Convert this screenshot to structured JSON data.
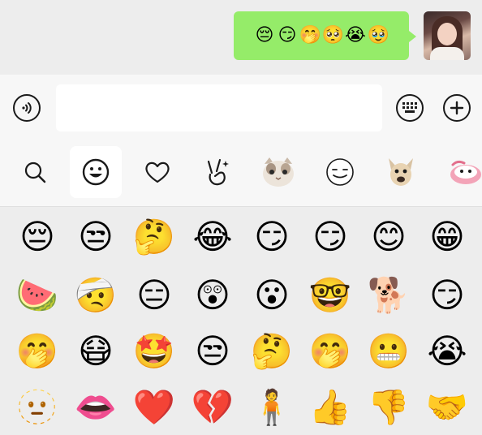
{
  "chat": {
    "sent_message_emojis": [
      "😔",
      "😏",
      "🤭",
      "🥺",
      "😭",
      "🥹"
    ]
  },
  "input": {
    "value": "",
    "placeholder": ""
  },
  "icons": {
    "voice": "voice-icon",
    "keyboard": "keyboard-icon",
    "plus": "plus-icon",
    "search": "search-icon",
    "smiley": "smiley-icon",
    "heart": "heart-icon",
    "gesture": "victory-hand-icon",
    "cat_sticker": "cat-sticker-icon",
    "doodle_face": "doodle-face-icon",
    "dog_sticker": "dog-sticker-icon",
    "pink_sticker": "pink-sticker-icon"
  },
  "colors": {
    "bubble": "#95ec69",
    "background": "#ededed",
    "bar": "#f7f7f7"
  },
  "emoji_grid": [
    [
      "😔",
      "😒",
      "🤔",
      "😂",
      "😏",
      "😏",
      "😊",
      "😁"
    ],
    [
      "🍉",
      "🤕",
      "😑",
      "😲",
      "😮",
      "🤓",
      "🐕",
      "😏"
    ],
    [
      "🤭",
      "😷",
      "🤩",
      "😒",
      "🤔",
      "🤭",
      "😬",
      "😭"
    ],
    [
      "🫥",
      "👄",
      "❤️",
      "💔",
      "🧍",
      "👍",
      "👎",
      "🤝"
    ]
  ]
}
